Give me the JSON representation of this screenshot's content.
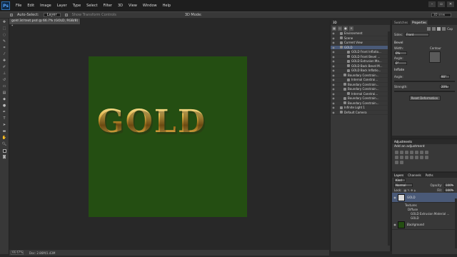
{
  "app": {
    "logo": "Ps"
  },
  "menu": [
    "File",
    "Edit",
    "Image",
    "Layer",
    "Type",
    "Select",
    "Filter",
    "3D",
    "View",
    "Window",
    "Help"
  ],
  "window_controls": [
    "–",
    "▫",
    "✕"
  ],
  "options_bar": {
    "auto_select_label": "Auto-Select:",
    "auto_select_value": "Layer",
    "show_transform_label": "Show Transform Controls",
    "mode_label": "3D Mode:",
    "workspace": "3D view"
  },
  "document": {
    "tab_title": "gold 3d text.psd @ 66.7% (GOLD, RGB/8) *",
    "canvas_text": "GOLD",
    "canvas_color": "#244e12"
  },
  "status": {
    "zoom": "66.67%",
    "doc": "Doc: 2.86M/1.43M"
  },
  "panel_3d": {
    "title": "3D",
    "rows": [
      {
        "label": "Environment",
        "indent": 1
      },
      {
        "label": "Scene",
        "indent": 1
      },
      {
        "label": "Current View",
        "indent": 1
      },
      {
        "label": "GOLD",
        "indent": 1,
        "selected": true
      },
      {
        "label": "GOLD Front Inflatio...",
        "indent": 3
      },
      {
        "label": "GOLD Front Bevel ...",
        "indent": 3
      },
      {
        "label": "GOLD Extrusion Ma...",
        "indent": 3
      },
      {
        "label": "GOLD Back Bevel M...",
        "indent": 3
      },
      {
        "label": "GOLD Back Inflatio...",
        "indent": 3
      },
      {
        "label": "Boundary Constrain...",
        "indent": 2
      },
      {
        "label": "Internal Constrai...",
        "indent": 3
      },
      {
        "label": "Boundary Constrain...",
        "indent": 2
      },
      {
        "label": "Boundary Constrain...",
        "indent": 2
      },
      {
        "label": "Internal Constrai...",
        "indent": 3
      },
      {
        "label": "Boundary Constrain...",
        "indent": 2
      },
      {
        "label": "Boundary Constrain...",
        "indent": 2
      },
      {
        "label": "Infinite Light 1",
        "indent": 1
      },
      {
        "label": "Default Camera",
        "indent": 1
      }
    ]
  },
  "properties": {
    "tabs": [
      "Swatches",
      "Properties"
    ],
    "icon_label": "Cap",
    "sides_label": "Sides:",
    "sides_value": "Front",
    "bevel_title": "Bevel",
    "width_label": "Width:",
    "width_value": "0%",
    "contour_label": "Contour",
    "angle_label": "Angle:",
    "angle_value": "0°",
    "inflate_title": "Inflate",
    "inf_angle_label": "Angle:",
    "inf_angle_value": "90°",
    "strength_label": "Strength:",
    "strength_value": "20%",
    "reset_button": "Reset Deformation"
  },
  "adjustments": {
    "title": "Adjustments",
    "subtitle": "Add an adjustment"
  },
  "layers": {
    "tabs": [
      "Layers",
      "Channels",
      "Paths"
    ],
    "kind_label": "Kind",
    "blend_mode": "Normal",
    "opacity_label": "Opacity:",
    "opacity_value": "100%",
    "lock_label": "Lock:",
    "fill_label": "Fill:",
    "fill_value": "100%",
    "items": [
      {
        "name": "GOLD",
        "selected": true,
        "thumb_color": "#d8d8d8"
      },
      {
        "name": "Background",
        "selected": false,
        "thumb_color": "#244e12"
      }
    ],
    "sub": [
      "Textures",
      "Diffuse",
      "GOLD Extrusion Material ...",
      "GOLD"
    ]
  }
}
